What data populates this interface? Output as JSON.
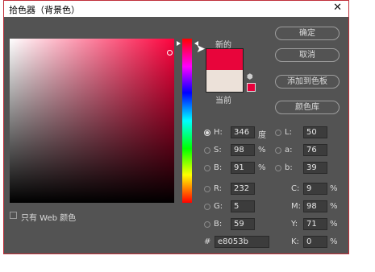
{
  "window": {
    "title": "拾色器（背景色）"
  },
  "swatches": {
    "new_label": "新的",
    "current_label": "当前",
    "new_color": "#e8053b",
    "current_color": "#ece1d9"
  },
  "buttons": {
    "ok": "确定",
    "cancel": "取消",
    "add_to_swatches": "添加到色板",
    "color_libraries": "颜色库"
  },
  "only_web_colors": {
    "label": "只有 Web 颜色",
    "checked": false
  },
  "hsb": {
    "h": "346",
    "h_unit": "度",
    "s": "98",
    "s_unit": "%",
    "b": "91",
    "b_unit": "%"
  },
  "rgb": {
    "r": "232",
    "g": "5",
    "b": "59"
  },
  "lab": {
    "l": "50",
    "a": "76",
    "b": "39"
  },
  "cmyk": {
    "c": "9",
    "m": "98",
    "y": "71",
    "k": "0",
    "unit": "%"
  },
  "labels": {
    "H": "H:",
    "S": "S:",
    "B": "B:",
    "R": "R:",
    "G": "G:",
    "Bb": "B:",
    "L": "L:",
    "a": "a:",
    "bl": "b:",
    "C": "C:",
    "M": "M:",
    "Y": "Y:",
    "K": "K:",
    "hash": "#"
  },
  "hex": "e8053b",
  "selected_mode": "H"
}
